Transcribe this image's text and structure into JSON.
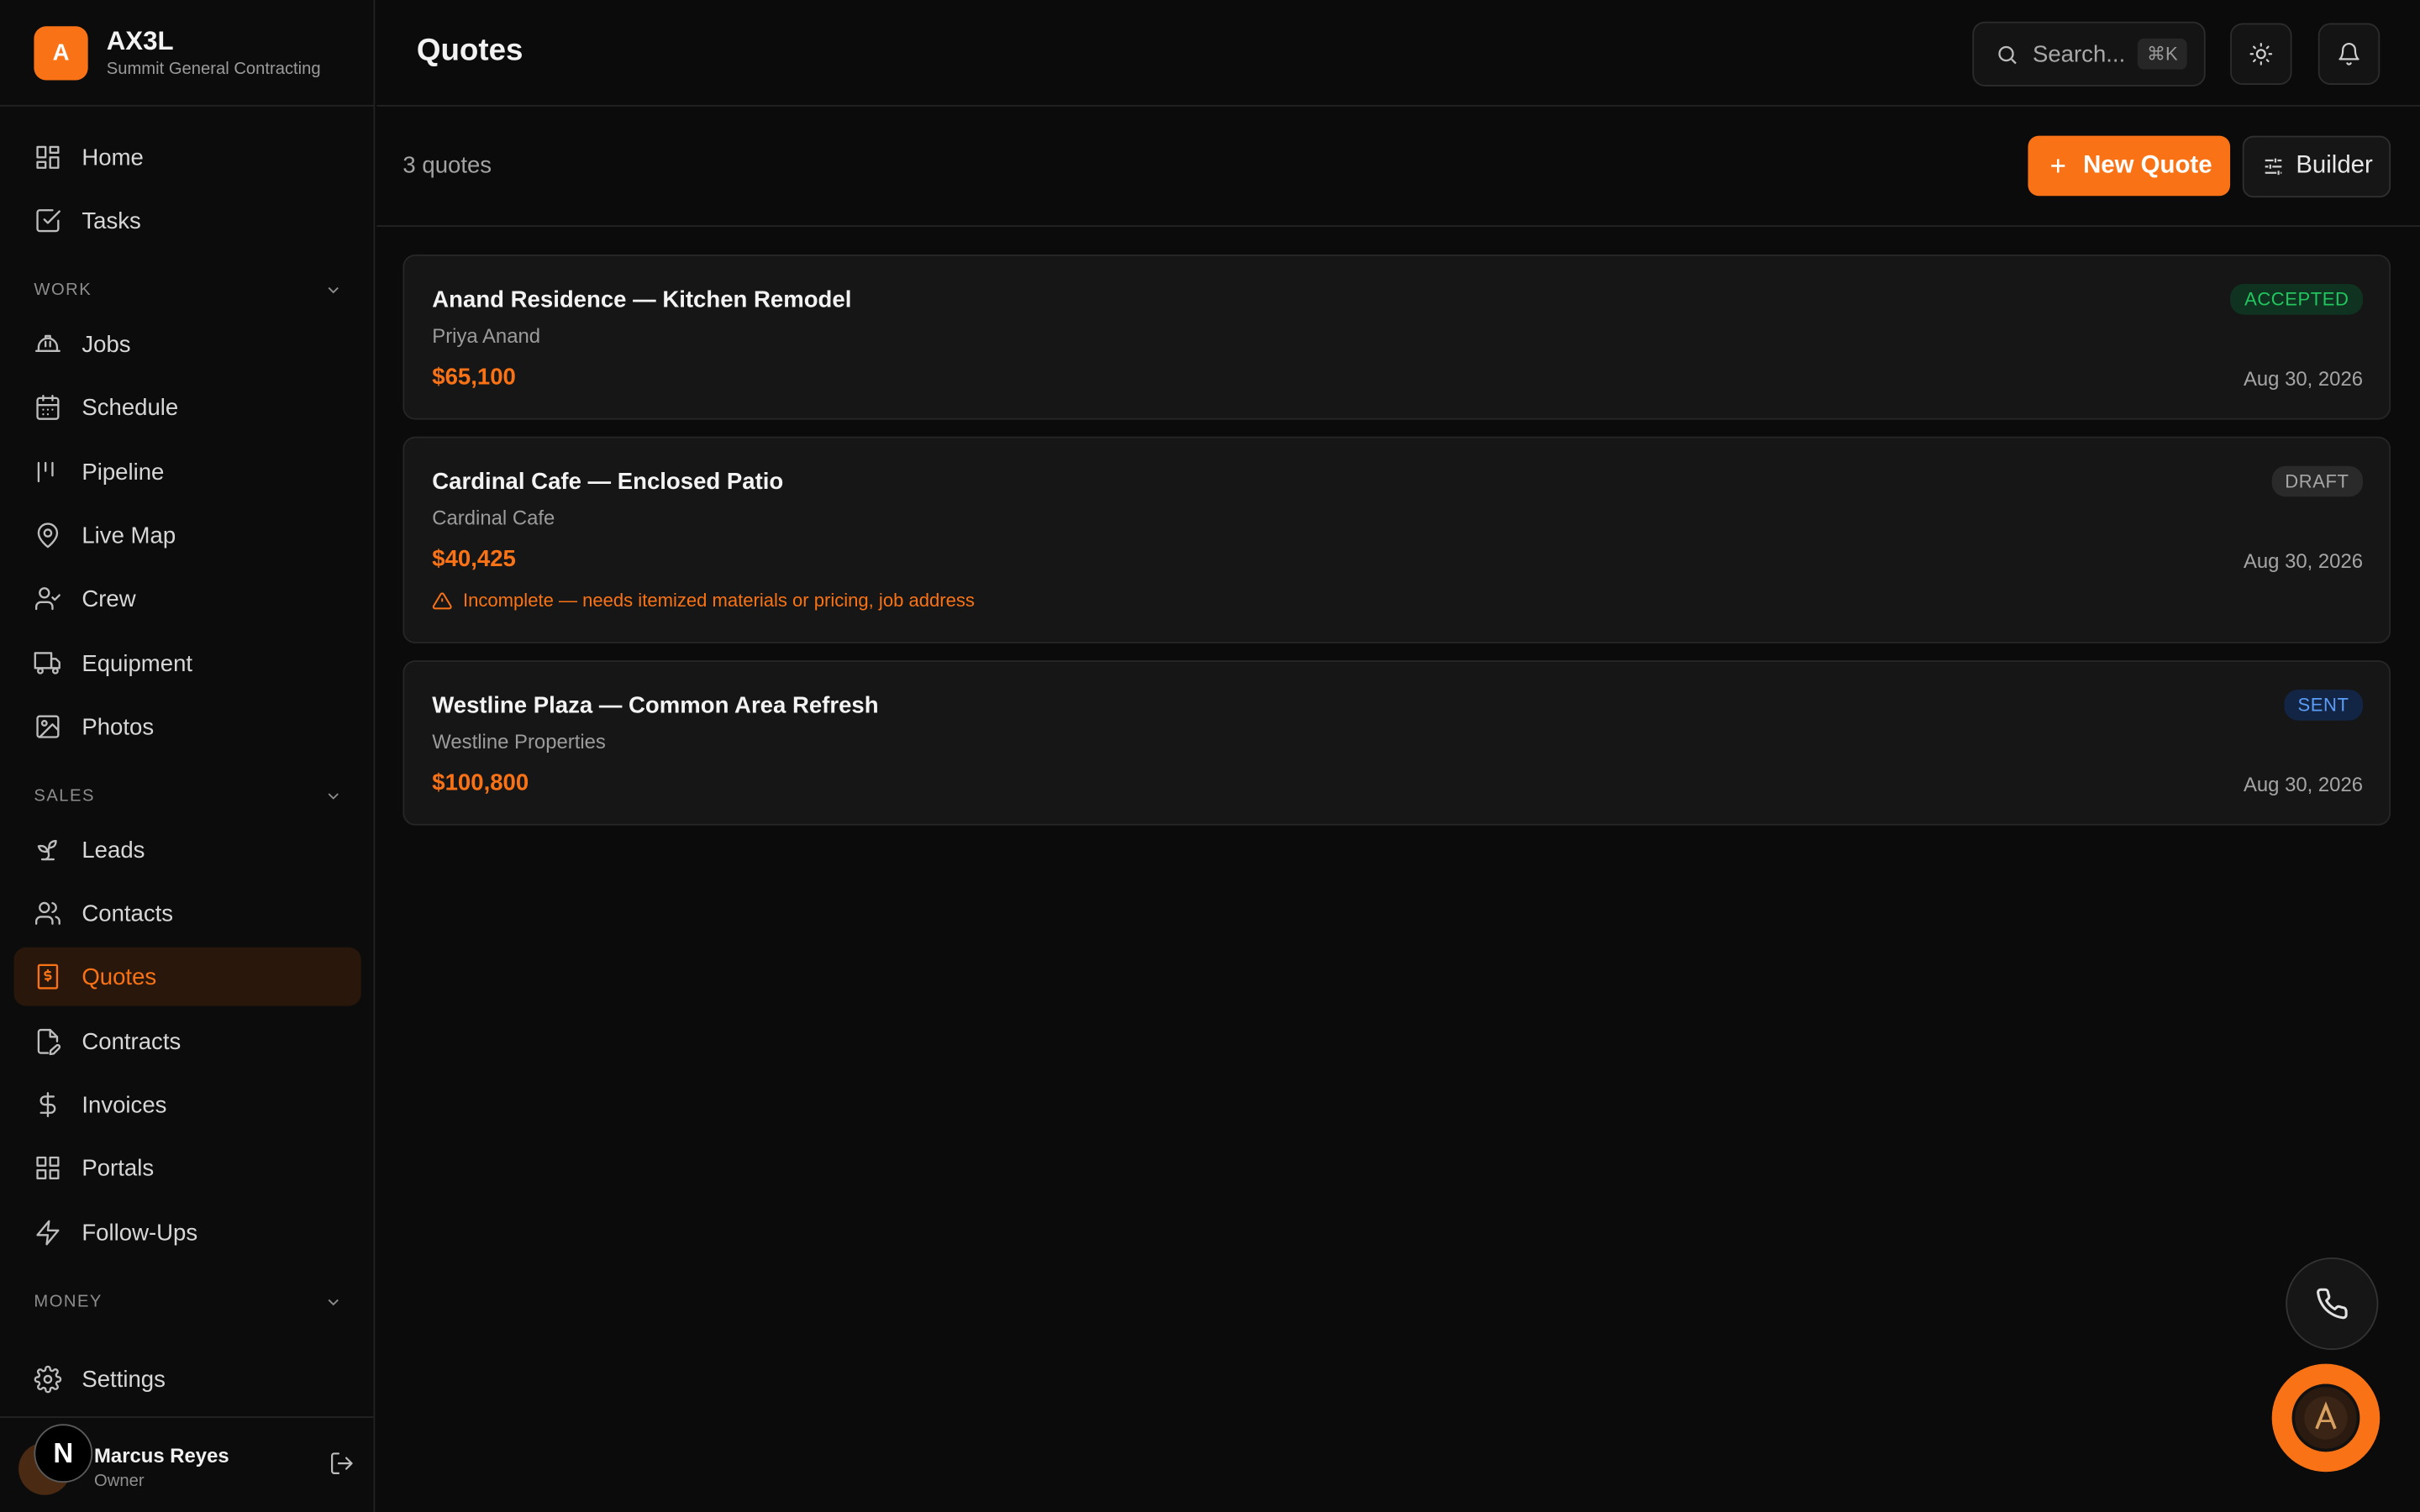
{
  "brand": {
    "initial": "A",
    "name": "AX3L",
    "company": "Summit General Contracting"
  },
  "header": {
    "title": "Quotes",
    "search_placeholder": "Search...",
    "search_shortcut": "⌘K"
  },
  "sidebar": {
    "top_items": [
      {
        "label": "Home",
        "icon": "grid-icon"
      },
      {
        "label": "Tasks",
        "icon": "checkbox-icon"
      }
    ],
    "sections": [
      {
        "title": "WORK",
        "items": [
          {
            "label": "Jobs",
            "icon": "hardhat-icon"
          },
          {
            "label": "Schedule",
            "icon": "calendar-icon"
          },
          {
            "label": "Pipeline",
            "icon": "pipeline-icon"
          },
          {
            "label": "Live Map",
            "icon": "map-pin-icon"
          },
          {
            "label": "Crew",
            "icon": "user-check-icon"
          },
          {
            "label": "Equipment",
            "icon": "truck-icon"
          },
          {
            "label": "Photos",
            "icon": "image-icon"
          }
        ]
      },
      {
        "title": "SALES",
        "items": [
          {
            "label": "Leads",
            "icon": "sprout-icon"
          },
          {
            "label": "Contacts",
            "icon": "users-icon"
          },
          {
            "label": "Quotes",
            "icon": "receipt-icon",
            "active": true
          },
          {
            "label": "Contracts",
            "icon": "file-pen-icon"
          },
          {
            "label": "Invoices",
            "icon": "dollar-icon"
          },
          {
            "label": "Portals",
            "icon": "grid-icon"
          },
          {
            "label": "Follow-Ups",
            "icon": "zap-icon"
          }
        ]
      },
      {
        "title": "MONEY",
        "items": []
      }
    ],
    "settings_label": "Settings"
  },
  "user": {
    "initial": "N",
    "name": "Marcus Reyes",
    "role": "Owner"
  },
  "toolbar": {
    "count_text": "3 quotes",
    "new_button": "New Quote",
    "builder_button": "Builder"
  },
  "quotes": [
    {
      "title": "Anand Residence — Kitchen Remodel",
      "client": "Priya Anand",
      "amount": "$65,100",
      "status": "ACCEPTED",
      "date": "Aug 30, 2026",
      "warning": ""
    },
    {
      "title": "Cardinal Cafe — Enclosed Patio",
      "client": "Cardinal Cafe",
      "amount": "$40,425",
      "status": "DRAFT",
      "date": "Aug 30, 2026",
      "warning": "Incomplete — needs itemized materials or pricing, job address"
    },
    {
      "title": "Westline Plaza — Common Area Refresh",
      "client": "Westline Properties",
      "amount": "$100,800",
      "status": "SENT",
      "date": "Aug 30, 2026",
      "warning": ""
    }
  ],
  "colors": {
    "accent": "#f97316",
    "accepted": "#22c55e",
    "sent": "#5b9cf6",
    "background": "#0b0b0b"
  }
}
